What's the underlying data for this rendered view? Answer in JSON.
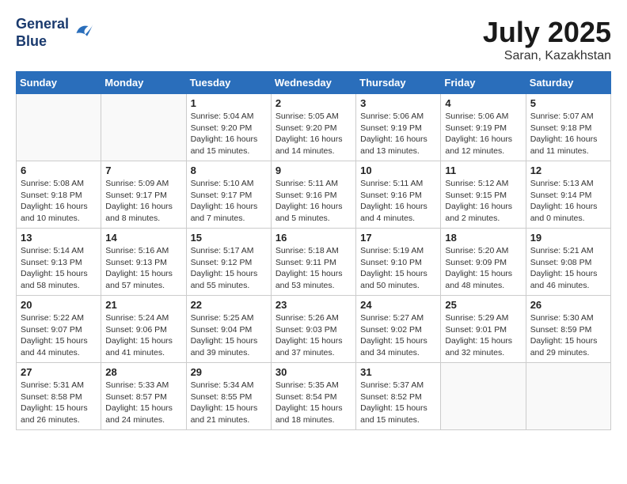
{
  "header": {
    "logo_line1": "General",
    "logo_line2": "Blue",
    "month_year": "July 2025",
    "location": "Saran, Kazakhstan"
  },
  "weekdays": [
    "Sunday",
    "Monday",
    "Tuesday",
    "Wednesday",
    "Thursday",
    "Friday",
    "Saturday"
  ],
  "weeks": [
    [
      {
        "day": "",
        "info": ""
      },
      {
        "day": "",
        "info": ""
      },
      {
        "day": "1",
        "info": "Sunrise: 5:04 AM\nSunset: 9:20 PM\nDaylight: 16 hours\nand 15 minutes."
      },
      {
        "day": "2",
        "info": "Sunrise: 5:05 AM\nSunset: 9:20 PM\nDaylight: 16 hours\nand 14 minutes."
      },
      {
        "day": "3",
        "info": "Sunrise: 5:06 AM\nSunset: 9:19 PM\nDaylight: 16 hours\nand 13 minutes."
      },
      {
        "day": "4",
        "info": "Sunrise: 5:06 AM\nSunset: 9:19 PM\nDaylight: 16 hours\nand 12 minutes."
      },
      {
        "day": "5",
        "info": "Sunrise: 5:07 AM\nSunset: 9:18 PM\nDaylight: 16 hours\nand 11 minutes."
      }
    ],
    [
      {
        "day": "6",
        "info": "Sunrise: 5:08 AM\nSunset: 9:18 PM\nDaylight: 16 hours\nand 10 minutes."
      },
      {
        "day": "7",
        "info": "Sunrise: 5:09 AM\nSunset: 9:17 PM\nDaylight: 16 hours\nand 8 minutes."
      },
      {
        "day": "8",
        "info": "Sunrise: 5:10 AM\nSunset: 9:17 PM\nDaylight: 16 hours\nand 7 minutes."
      },
      {
        "day": "9",
        "info": "Sunrise: 5:11 AM\nSunset: 9:16 PM\nDaylight: 16 hours\nand 5 minutes."
      },
      {
        "day": "10",
        "info": "Sunrise: 5:11 AM\nSunset: 9:16 PM\nDaylight: 16 hours\nand 4 minutes."
      },
      {
        "day": "11",
        "info": "Sunrise: 5:12 AM\nSunset: 9:15 PM\nDaylight: 16 hours\nand 2 minutes."
      },
      {
        "day": "12",
        "info": "Sunrise: 5:13 AM\nSunset: 9:14 PM\nDaylight: 16 hours\nand 0 minutes."
      }
    ],
    [
      {
        "day": "13",
        "info": "Sunrise: 5:14 AM\nSunset: 9:13 PM\nDaylight: 15 hours\nand 58 minutes."
      },
      {
        "day": "14",
        "info": "Sunrise: 5:16 AM\nSunset: 9:13 PM\nDaylight: 15 hours\nand 57 minutes."
      },
      {
        "day": "15",
        "info": "Sunrise: 5:17 AM\nSunset: 9:12 PM\nDaylight: 15 hours\nand 55 minutes."
      },
      {
        "day": "16",
        "info": "Sunrise: 5:18 AM\nSunset: 9:11 PM\nDaylight: 15 hours\nand 53 minutes."
      },
      {
        "day": "17",
        "info": "Sunrise: 5:19 AM\nSunset: 9:10 PM\nDaylight: 15 hours\nand 50 minutes."
      },
      {
        "day": "18",
        "info": "Sunrise: 5:20 AM\nSunset: 9:09 PM\nDaylight: 15 hours\nand 48 minutes."
      },
      {
        "day": "19",
        "info": "Sunrise: 5:21 AM\nSunset: 9:08 PM\nDaylight: 15 hours\nand 46 minutes."
      }
    ],
    [
      {
        "day": "20",
        "info": "Sunrise: 5:22 AM\nSunset: 9:07 PM\nDaylight: 15 hours\nand 44 minutes."
      },
      {
        "day": "21",
        "info": "Sunrise: 5:24 AM\nSunset: 9:06 PM\nDaylight: 15 hours\nand 41 minutes."
      },
      {
        "day": "22",
        "info": "Sunrise: 5:25 AM\nSunset: 9:04 PM\nDaylight: 15 hours\nand 39 minutes."
      },
      {
        "day": "23",
        "info": "Sunrise: 5:26 AM\nSunset: 9:03 PM\nDaylight: 15 hours\nand 37 minutes."
      },
      {
        "day": "24",
        "info": "Sunrise: 5:27 AM\nSunset: 9:02 PM\nDaylight: 15 hours\nand 34 minutes."
      },
      {
        "day": "25",
        "info": "Sunrise: 5:29 AM\nSunset: 9:01 PM\nDaylight: 15 hours\nand 32 minutes."
      },
      {
        "day": "26",
        "info": "Sunrise: 5:30 AM\nSunset: 8:59 PM\nDaylight: 15 hours\nand 29 minutes."
      }
    ],
    [
      {
        "day": "27",
        "info": "Sunrise: 5:31 AM\nSunset: 8:58 PM\nDaylight: 15 hours\nand 26 minutes."
      },
      {
        "day": "28",
        "info": "Sunrise: 5:33 AM\nSunset: 8:57 PM\nDaylight: 15 hours\nand 24 minutes."
      },
      {
        "day": "29",
        "info": "Sunrise: 5:34 AM\nSunset: 8:55 PM\nDaylight: 15 hours\nand 21 minutes."
      },
      {
        "day": "30",
        "info": "Sunrise: 5:35 AM\nSunset: 8:54 PM\nDaylight: 15 hours\nand 18 minutes."
      },
      {
        "day": "31",
        "info": "Sunrise: 5:37 AM\nSunset: 8:52 PM\nDaylight: 15 hours\nand 15 minutes."
      },
      {
        "day": "",
        "info": ""
      },
      {
        "day": "",
        "info": ""
      }
    ]
  ]
}
